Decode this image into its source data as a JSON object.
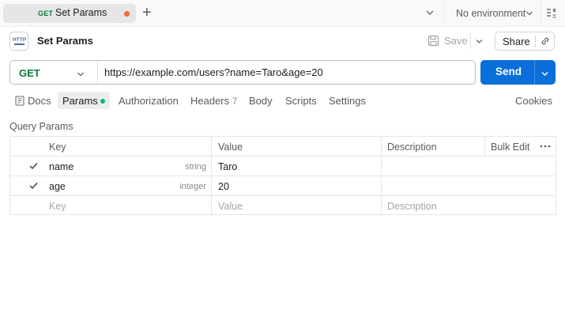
{
  "tabbar": {
    "tab_method": "GET",
    "tab_title": "Set Params",
    "environment": "No environment",
    "colors": {
      "unsaved_dot": "#f26b3a"
    }
  },
  "request": {
    "title": "Set Params",
    "icon_label": "HTTP",
    "save_label": "Save",
    "share_label": "Share",
    "method": "GET",
    "url": "https://example.com/users?name=Taro&age=20",
    "send_label": "Send",
    "colors": {
      "method": "#0e7a3c",
      "send": "#0b6fdb"
    }
  },
  "subtabs": {
    "docs": "Docs",
    "params": "Params",
    "authorization": "Authorization",
    "headers": "Headers",
    "headers_count": "7",
    "body": "Body",
    "scripts": "Scripts",
    "settings": "Settings",
    "cookies": "Cookies",
    "colors": {
      "params_indicator": "#0cba6f"
    }
  },
  "query_params": {
    "section_title": "Query Params",
    "columns": {
      "key": "Key",
      "value": "Value",
      "description": "Description",
      "bulk_edit": "Bulk Edit"
    },
    "rows": [
      {
        "key": "name",
        "type": "string",
        "value": "Taro",
        "description": ""
      },
      {
        "key": "age",
        "type": "integer",
        "value": "20",
        "description": ""
      }
    ],
    "placeholder": {
      "key": "Key",
      "value": "Value",
      "description": "Description"
    }
  }
}
